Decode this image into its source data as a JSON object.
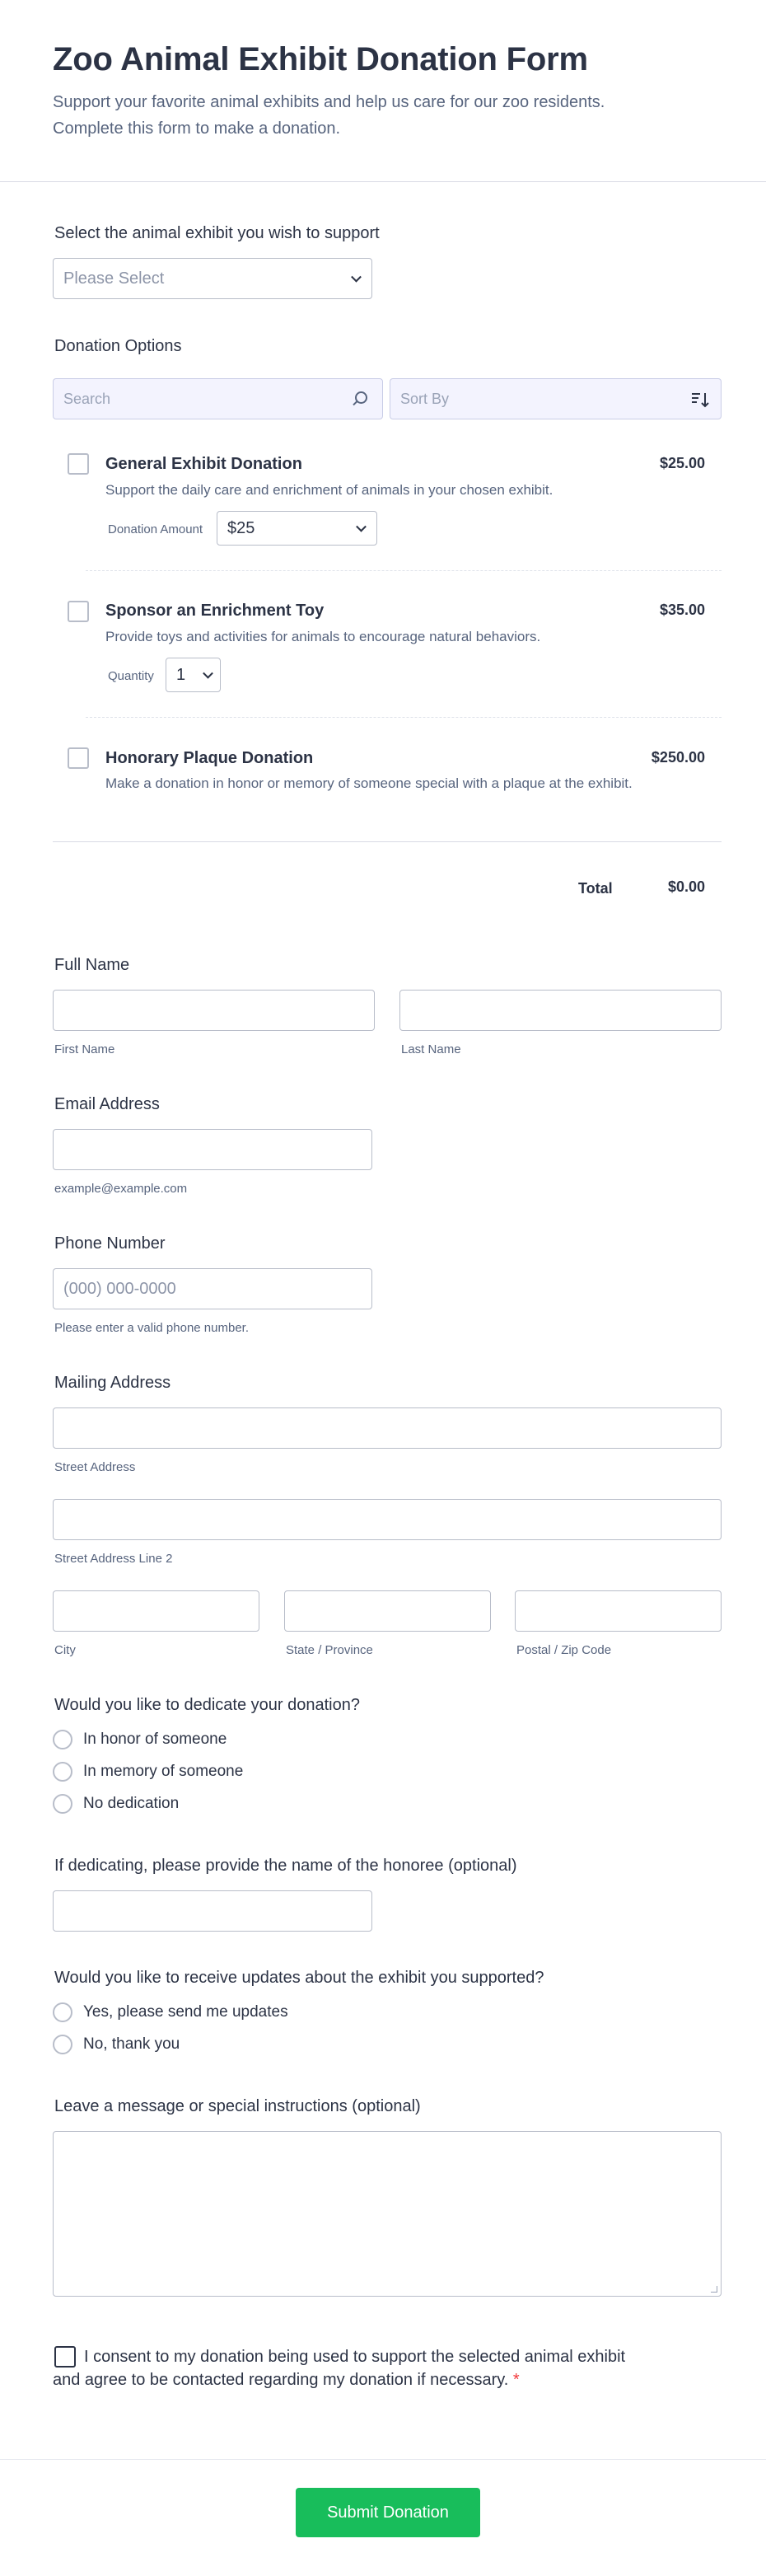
{
  "header": {
    "title": "Zoo Animal Exhibit Donation Form",
    "subtitle": "Support your favorite animal exhibits and help us care for our zoo residents. Complete this form to make a donation."
  },
  "exhibit": {
    "label": "Select the animal exhibit you wish to support",
    "placeholder": "Please Select"
  },
  "donation_options": {
    "label": "Donation Options",
    "search_placeholder": "Search",
    "sort_placeholder": "Sort By",
    "products": [
      {
        "name": "General Exhibit Donation",
        "description": "Support the daily care and enrichment of animals in your chosen exhibit.",
        "price": "$25.00",
        "option_label": "Donation Amount",
        "option_value": "$25"
      },
      {
        "name": "Sponsor an Enrichment Toy",
        "description": "Provide toys and activities for animals to encourage natural behaviors.",
        "price": "$35.00",
        "option_label": "Quantity",
        "option_value": "1"
      },
      {
        "name": "Honorary Plaque Donation",
        "description": "Make a donation in honor or memory of someone special with a plaque at the exhibit.",
        "price": "$250.00"
      }
    ],
    "total_label": "Total",
    "total_value": "$0.00"
  },
  "full_name": {
    "label": "Full Name",
    "first_sublabel": "First Name",
    "last_sublabel": "Last Name"
  },
  "email": {
    "label": "Email Address",
    "sublabel": "example@example.com"
  },
  "phone": {
    "label": "Phone Number",
    "placeholder": "(000) 000-0000",
    "sublabel": "Please enter a valid phone number."
  },
  "address": {
    "label": "Mailing Address",
    "street_sublabel": "Street Address",
    "street2_sublabel": "Street Address Line 2",
    "city_sublabel": "City",
    "state_sublabel": "State / Province",
    "postal_sublabel": "Postal / Zip Code"
  },
  "dedication": {
    "label": "Would you like to dedicate your donation?",
    "options": [
      "In honor of someone",
      "In memory of someone",
      "No dedication"
    ]
  },
  "honoree": {
    "label": "If dedicating, please provide the name of the honoree (optional)"
  },
  "updates": {
    "label": "Would you like to receive updates about the exhibit you supported?",
    "options": [
      "Yes, please send me updates",
      "No, thank you"
    ]
  },
  "message": {
    "label": "Leave a message or special instructions (optional)"
  },
  "consent": {
    "text": "I consent to my donation being used to support the selected animal exhibit and agree to be contacted regarding my donation if necessary.",
    "required_mark": "*"
  },
  "submit": {
    "label": "Submit Donation"
  },
  "colors": {
    "submit": "#18bd5b",
    "required": "#f23a3c",
    "text": "#2c3345",
    "muted": "#57647e"
  }
}
